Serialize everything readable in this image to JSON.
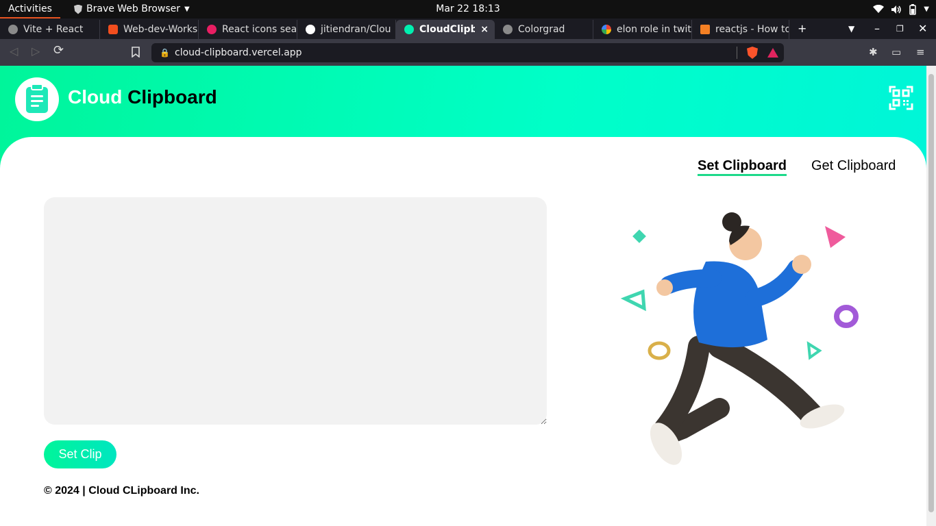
{
  "os": {
    "activities": "Activities",
    "app_name": "Brave Web Browser",
    "datetime": "Mar 22  18:13"
  },
  "tabs": [
    {
      "label": "Vite + React",
      "favicon_color": "#8a8a8a"
    },
    {
      "label": "Web-dev-Works",
      "favicon_color": "#f24e1e"
    },
    {
      "label": "React icons sea",
      "favicon_color": "#e91e63"
    },
    {
      "label": "jitiendran/Clou",
      "favicon_color": "#ffffff"
    },
    {
      "label": "CloudClipbo",
      "favicon_color": "#00f0b0",
      "active": true
    },
    {
      "label": "Colorgrad",
      "favicon_color": "#8a8a8a"
    },
    {
      "label": "elon role in twit",
      "favicon_color": "#4285f4"
    },
    {
      "label": "reactjs - How to",
      "favicon_color": "#f48024"
    }
  ],
  "browser": {
    "url": "cloud-clipboard.vercel.app",
    "new_tab": "+",
    "tab_close": "×"
  },
  "app": {
    "brand_first": "Cloud",
    "brand_second": "Clipboard",
    "nav_set": "Set Clipboard",
    "nav_get": "Get Clipboard",
    "textarea_value": "",
    "button_label": "Set Clip",
    "footer": "© 2024 | Cloud CLipboard Inc.",
    "accent_color": "#00f59a",
    "icons": [
      "clipboard-icon",
      "qr-code-scan-icon"
    ]
  }
}
